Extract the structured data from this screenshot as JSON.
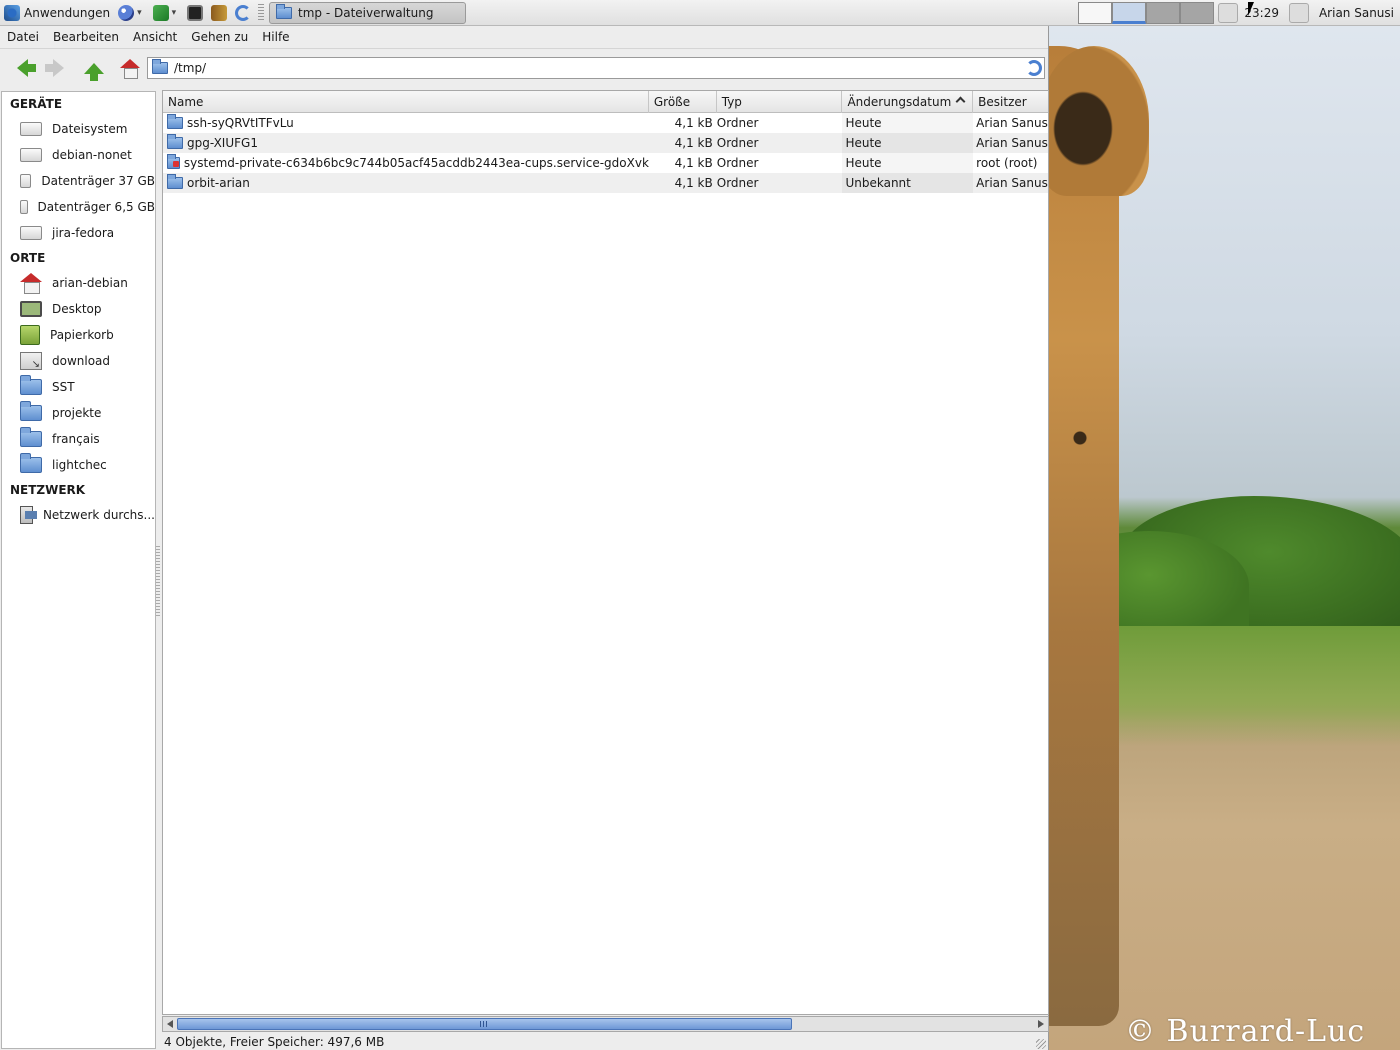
{
  "panel": {
    "apps_label": "Anwendungen",
    "task_title": "tmp - Dateiverwaltung",
    "clock": "23:29",
    "user": "Arian Sanusi"
  },
  "menubar": {
    "items": [
      "Datei",
      "Bearbeiten",
      "Ansicht",
      "Gehen zu",
      "Hilfe"
    ]
  },
  "location": {
    "path": "/tmp/"
  },
  "sidebar": {
    "devices_head": "GERÄTE",
    "devices": [
      "Dateisystem",
      "debian-nonet",
      "Datenträger 37 GB",
      "Datenträger 6,5 GB",
      "jira-fedora"
    ],
    "places_head": "ORTE",
    "places": [
      "arian-debian",
      "Desktop",
      "Papierkorb",
      "download",
      "SST",
      "projekte",
      "français",
      "lightchec"
    ],
    "network_head": "NETZWERK",
    "network": [
      "Netzwerk durchs..."
    ]
  },
  "filelist": {
    "columns": [
      "Name",
      "Größe",
      "Typ",
      "Änderungsdatum",
      "Besitzer"
    ],
    "rows": [
      {
        "name": "ssh-syQRVtITFvLu",
        "size": "4,1 kB",
        "type": "Ordner",
        "date": "Heute",
        "owner": "Arian Sanusi ("
      },
      {
        "name": "gpg-XIUFG1",
        "size": "4,1 kB",
        "type": "Ordner",
        "date": "Heute",
        "owner": "Arian Sanusi ("
      },
      {
        "name": "systemd-private-c634b6bc9c744b05acf45acddb2443ea-cups.service-gdoXvk",
        "size": "4,1 kB",
        "type": "Ordner",
        "date": "Heute",
        "owner": "root (root)"
      },
      {
        "name": "orbit-arian",
        "size": "4,1 kB",
        "type": "Ordner",
        "date": "Unbekannt",
        "owner": "Arian Sanusi ("
      }
    ]
  },
  "statusbar": {
    "text": "4 Objekte, Freier Speicher: 497,6 MB"
  },
  "wallpaper": {
    "copyright": "© Burrard-Luc"
  },
  "colors": {
    "accent": "#4a7fd0",
    "nav_green": "#4aa02c",
    "home_red": "#c62b2b"
  }
}
